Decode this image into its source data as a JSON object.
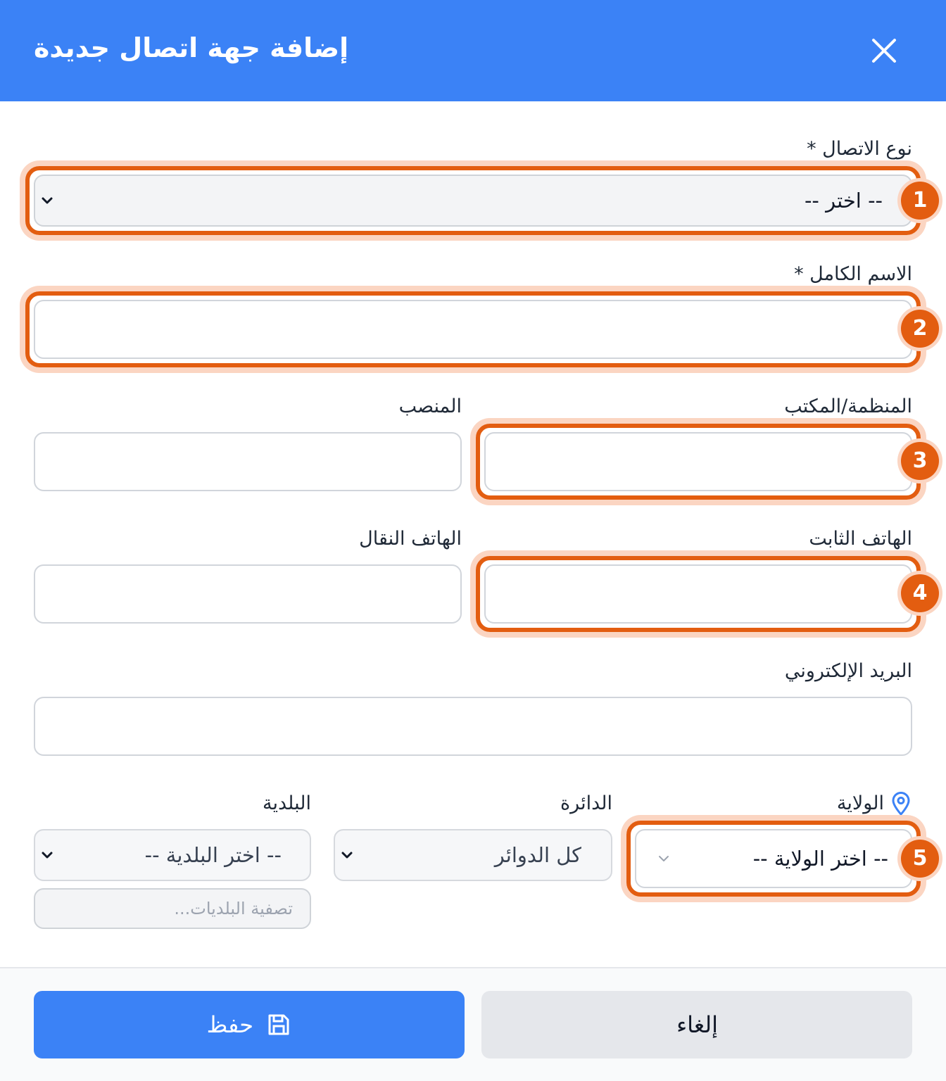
{
  "dialog": {
    "title": "إضافة جهة اتصال جديدة"
  },
  "form": {
    "contact_type": {
      "label": "نوع الاتصال *",
      "value": "-- اختر --"
    },
    "full_name": {
      "label": "الاسم الكامل *",
      "value": ""
    },
    "organization": {
      "label": "المنظمة/المكتب",
      "value": ""
    },
    "position": {
      "label": "المنصب",
      "value": ""
    },
    "landline": {
      "label": "الهاتف الثابت",
      "value": ""
    },
    "mobile": {
      "label": "الهاتف النقال",
      "value": ""
    },
    "email": {
      "label": "البريد الإلكتروني",
      "value": ""
    },
    "wilaya": {
      "label": "الولاية",
      "value": "-- اختر الولاية --"
    },
    "daira": {
      "label": "الدائرة",
      "value": "كل الدوائر"
    },
    "commune": {
      "label": "البلدية",
      "value": "-- اختر البلدية --",
      "filter_placeholder": "تصفية البلديات..."
    }
  },
  "callouts": [
    "1",
    "2",
    "3",
    "4",
    "5"
  ],
  "footer": {
    "save_label": "حفظ",
    "cancel_label": "إلغاء"
  },
  "colors": {
    "header": "#3b82f6",
    "primary": "#3b82f6",
    "highlight": "#e35d10"
  },
  "icons": {
    "close": "close-icon",
    "location": "map-pin-icon",
    "save": "save-icon",
    "chevron": "chevron-down-icon"
  }
}
